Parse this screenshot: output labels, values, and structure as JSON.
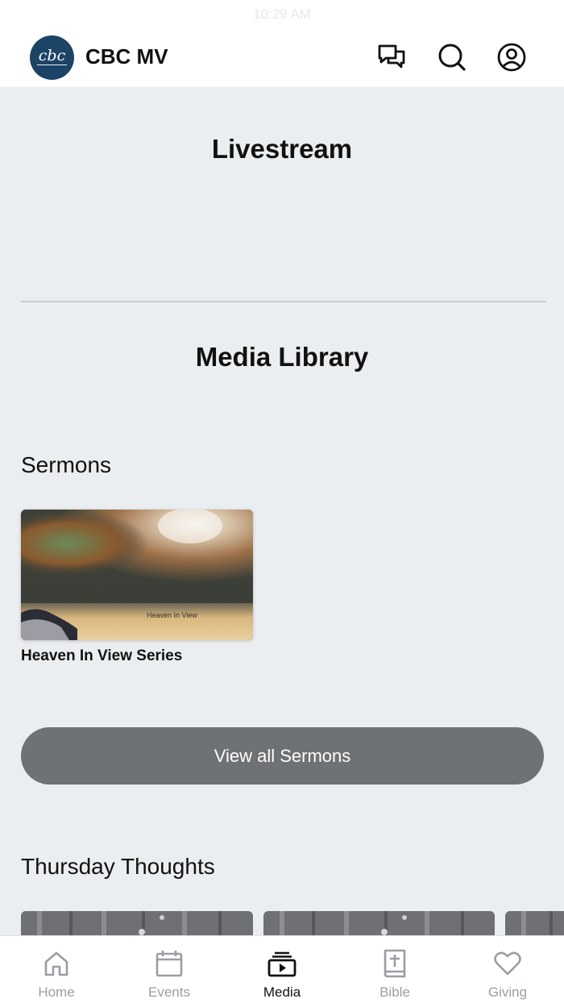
{
  "status_bar": {
    "time": "10:29 AM"
  },
  "header": {
    "logo_text": "cbc",
    "title": "CBC MV",
    "icons": [
      "chat-icon",
      "search-icon",
      "account-icon"
    ]
  },
  "livestream": {
    "title": "Livestream"
  },
  "media_library": {
    "title": "Media Library",
    "sermons": {
      "row_title": "Sermons",
      "items": [
        {
          "image_text": "Heaven In View",
          "caption": "Heaven In View Series"
        }
      ],
      "view_all_label": "View all Sermons"
    },
    "thursday_thoughts": {
      "row_title": "Thursday Thoughts"
    }
  },
  "tab_bar": {
    "items": [
      {
        "label": "Home",
        "icon": "home-icon"
      },
      {
        "label": "Events",
        "icon": "calendar-icon"
      },
      {
        "label": "Media",
        "icon": "media-icon",
        "active": true
      },
      {
        "label": "Bible",
        "icon": "bible-icon"
      },
      {
        "label": "Giving",
        "icon": "heart-icon"
      }
    ]
  },
  "colors": {
    "page_bg": "#ebeef0",
    "header_bg": "#ffffff",
    "logo_bg": "#1c4466",
    "button_bg": "#6f7275",
    "tab_inactive": "#9a9ea2",
    "tab_active": "#111111"
  }
}
